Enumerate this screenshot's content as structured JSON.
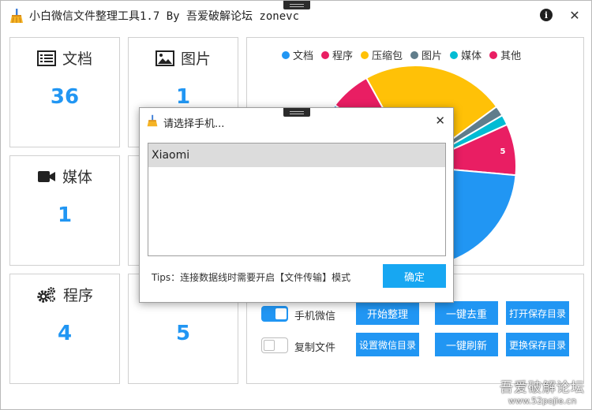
{
  "window": {
    "title": "小白微信文件整理工具1.7 By 吾爱破解论坛 zonevc",
    "info_glyph": "i",
    "close_glyph": "✕"
  },
  "cards": [
    {
      "label": "文档",
      "value": "36",
      "icon": "document-list-icon"
    },
    {
      "label": "图片",
      "value": "1",
      "icon": "picture-icon"
    },
    {
      "label": "媒体",
      "value": "1",
      "icon": "video-camera-icon"
    },
    {
      "label": "",
      "value": "",
      "icon": ""
    },
    {
      "label": "程序",
      "value": "4",
      "icon": "gears-icon"
    },
    {
      "label": "",
      "value": "5",
      "icon": ""
    }
  ],
  "chart_data": {
    "type": "pie",
    "legend_position": "top",
    "categories": [
      "文档",
      "程序",
      "压缩包",
      "图片",
      "媒体",
      "其他"
    ],
    "values": [
      36,
      4,
      14,
      1,
      1,
      5
    ],
    "colors": [
      "#2196f3",
      "#e91e63",
      "#ffc107",
      "#607d8b",
      "#00bcd4",
      "#e91e63"
    ],
    "data_labels": [
      "36",
      "",
      "",
      "",
      "",
      "5"
    ]
  },
  "controls": {
    "toggle_wechat": {
      "label": "手机微信",
      "state": "on"
    },
    "toggle_copy": {
      "label": "复制文件",
      "state": "off"
    },
    "buttons": {
      "start": "开始整理",
      "dedupe": "一键去重",
      "open_dir": "打开保存目录",
      "set_wechat_dir": "设置微信目录",
      "refresh": "一键刷新",
      "change_dir": "更换保存目录"
    }
  },
  "dialog": {
    "title": "请选择手机...",
    "close_glyph": "✕",
    "phones": [
      "Xiaomi"
    ],
    "tips": "Tips：连接数据线时需要开启【文件传输】模式",
    "ok_label": "确定"
  },
  "watermark": {
    "line1": "吾爱破解论坛",
    "line2": "www.52pojie.cn"
  }
}
